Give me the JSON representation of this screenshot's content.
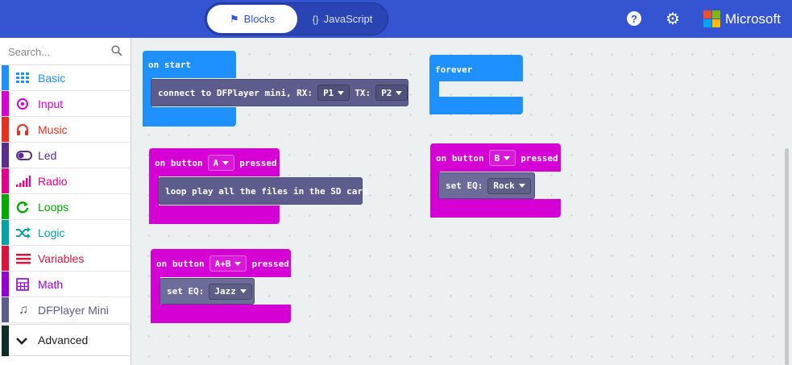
{
  "header": {
    "tabs": [
      {
        "label": "Blocks",
        "icon": "puzzle-icon",
        "active": true
      },
      {
        "label": "JavaScript",
        "icon": "braces-icon",
        "active": false
      }
    ],
    "brand": "Microsoft",
    "colors": {
      "bar": "#3454d1"
    }
  },
  "sidebar": {
    "search_placeholder": "Search...",
    "categories": [
      {
        "label": "Basic",
        "icon": "grid-icon",
        "color": "#1e90ff"
      },
      {
        "label": "Input",
        "icon": "target-icon",
        "color": "#d400d4"
      },
      {
        "label": "Music",
        "icon": "headphones-icon",
        "color": "#e63022"
      },
      {
        "label": "Led",
        "icon": "toggle-icon",
        "color": "#5c2d91"
      },
      {
        "label": "Radio",
        "icon": "signal-icon",
        "color": "#e3008c"
      },
      {
        "label": "Loops",
        "icon": "refresh-icon",
        "color": "#00aa00"
      },
      {
        "label": "Logic",
        "icon": "shuffle-icon",
        "color": "#00a4a6"
      },
      {
        "label": "Variables",
        "icon": "lines-icon",
        "color": "#dc143c"
      },
      {
        "label": "Math",
        "icon": "calculator-icon",
        "color": "#9400d3"
      },
      {
        "label": "DFPlayer Mini",
        "icon": "music-note-icon",
        "color": "#5c5d8c"
      }
    ],
    "advanced": {
      "label": "Advanced",
      "icon": "chevron-down-icon"
    }
  },
  "workspace": {
    "on_start": {
      "label": "on start",
      "color": "#1e90ff",
      "statement": {
        "text": "connect to DFPlayer mini, RX:",
        "rx": "P1",
        "tx_label": "TX:",
        "tx": "P2"
      }
    },
    "forever": {
      "label": "forever",
      "color": "#1e90ff"
    },
    "button_a": {
      "prefix": "on button",
      "button": "A",
      "suffix": "pressed",
      "color": "#d400d4",
      "statement": {
        "text": "loop play all the files in the SD card"
      }
    },
    "button_b": {
      "prefix": "on button",
      "button": "B",
      "suffix": "pressed",
      "color": "#d400d4",
      "statement": {
        "text": "set EQ:",
        "value": "Rock"
      }
    },
    "button_ab": {
      "prefix": "on button",
      "button": "A+B",
      "suffix": "pressed",
      "color": "#d400d4",
      "statement": {
        "text": "set EQ:",
        "value": "Jazz"
      }
    }
  }
}
